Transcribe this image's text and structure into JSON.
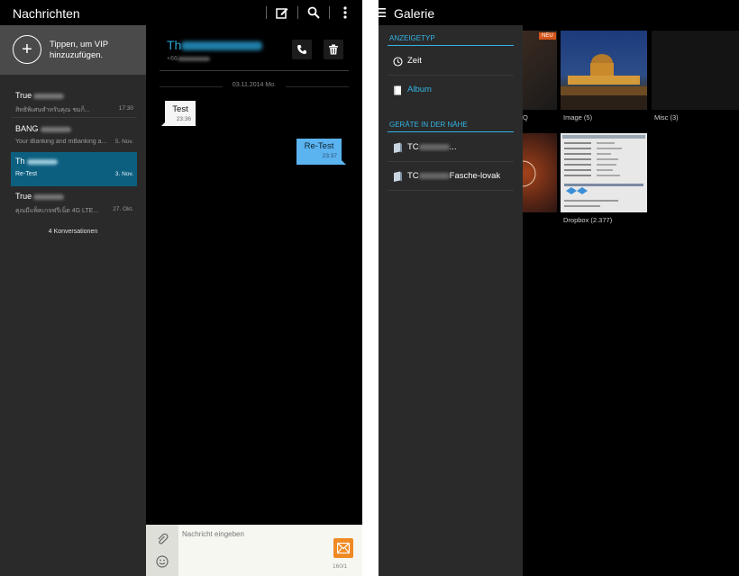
{
  "messages_app": {
    "title": "Nachrichten",
    "vip": {
      "plus": "+",
      "text": "Tippen, um VIP hinzuzufügen."
    },
    "conversations": [
      {
        "name": "True",
        "snippet": "สิทธิพิเศษสำหรับคุณ ชมก็...",
        "date": "17:30",
        "active": false
      },
      {
        "name": "BANG",
        "snippet": "Your iBanking and mBanking a...",
        "date": "5. Nov.",
        "active": false
      },
      {
        "name": "Th",
        "snippet": "Re-Test",
        "date": "3. Nov.",
        "active": true
      },
      {
        "name": "True",
        "snippet": "คุณมีแพ็คเกจฟรีเน็ต 4G LTE...",
        "date": "27. Okt.",
        "active": false
      }
    ],
    "conversation_count": "4 Konversationen",
    "chat": {
      "contact_name": "Th",
      "contact_number": "+66",
      "date_separator": "03.11.2014 Mo.",
      "messages": [
        {
          "direction": "in",
          "text": "Test",
          "time": "23:36"
        },
        {
          "direction": "out",
          "text": "Re-Test",
          "time": "23:37"
        }
      ]
    },
    "compose": {
      "placeholder": "Nachricht eingeben",
      "char_count": "160/1"
    }
  },
  "gallery_app": {
    "title": "Galerie",
    "drawer": {
      "section_view_type": "ANZEIGETYP",
      "view_items": [
        {
          "label": "Zeit",
          "icon": "clock-icon",
          "selected": false
        },
        {
          "label": "Album",
          "icon": "album-icon",
          "selected": true
        }
      ],
      "section_nearby": "GERÄTE IN DER NÄHE",
      "devices": [
        {
          "label": "TC",
          "suffix": "...",
          "icon": "device-icon"
        },
        {
          "label": "TC",
          "suffix": "Fasche-lovak",
          "icon": "device-icon"
        }
      ]
    },
    "albums": [
      {
        "label": "Q",
        "badge": "NEU"
      },
      {
        "label": "Image (5)"
      },
      {
        "label": "Misc (3)"
      },
      {
        "label": ""
      },
      {
        "label": "Dropbox (2.377)"
      }
    ]
  },
  "colors": {
    "accent_blue": "#33b5e5",
    "active_conversation": "#0d5f80",
    "outgoing_bubble": "#5bb3ef",
    "send_button": "#f08a24",
    "new_badge": "#d5561b"
  }
}
